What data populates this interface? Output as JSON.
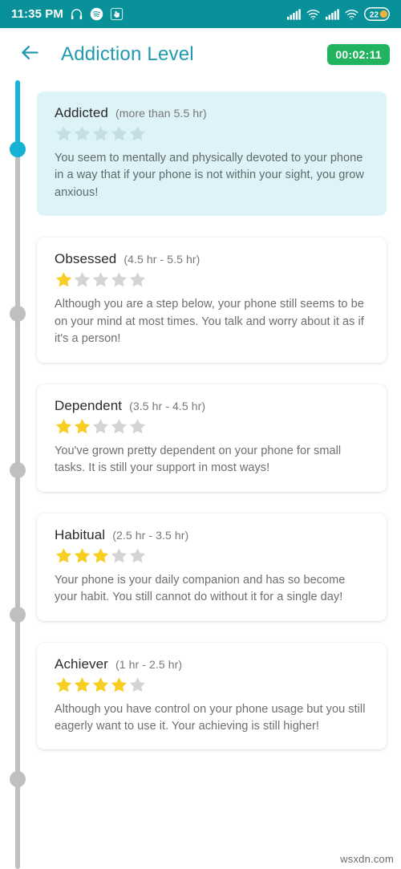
{
  "status_bar": {
    "time": "11:35 PM",
    "background": "#089199",
    "left_icons": [
      "headphones-icon",
      "spotify-icon",
      "touch-gesture-icon"
    ],
    "right_icons": [
      "signal-bars-icon",
      "wifi-calling-icon",
      "signal-bars-2-icon",
      "wifi-icon"
    ],
    "battery_percent": "22"
  },
  "app_bar": {
    "back_icon": "back-arrow-icon",
    "title": "Addiction Level",
    "title_color": "#1f9aae",
    "timer": "00:02:11",
    "timer_color": "#22b35e"
  },
  "timeline": {
    "active_color": "#16b2d4",
    "inactive_color": "#bfbfbf"
  },
  "levels": [
    {
      "name": "Addicted",
      "range": "(more than 5.5 hr)",
      "stars_filled": 0,
      "stars_total": 5,
      "description": "You seem to mentally and physically devoted to your phone in a way that if your phone is not within your sight, you grow anxious!",
      "highlighted": true,
      "background": "#ddf3f7"
    },
    {
      "name": "Obsessed",
      "range": "(4.5 hr - 5.5 hr)",
      "stars_filled": 1,
      "stars_total": 5,
      "description": "Although you are a step below, your phone still seems to be on your mind at most times. You talk and worry about it as if it's a person!",
      "highlighted": false,
      "background": "#ffffff"
    },
    {
      "name": "Dependent",
      "range": "(3.5 hr - 4.5 hr)",
      "stars_filled": 2,
      "stars_total": 5,
      "description": "You've grown pretty dependent on your phone for small tasks. It is still your support in most ways!",
      "highlighted": false,
      "background": "#ffffff"
    },
    {
      "name": "Habitual",
      "range": "(2.5 hr - 3.5 hr)",
      "stars_filled": 3,
      "stars_total": 5,
      "description": "Your phone is your daily companion and has so become your habit. You still cannot do without it for a single day!",
      "highlighted": false,
      "background": "#ffffff"
    },
    {
      "name": "Achiever",
      "range": "(1 hr - 2.5 hr)",
      "stars_filled": 4,
      "stars_total": 5,
      "description": "Although you have control on your phone usage but you still eagerly want to use it. Your achieving is still higher!",
      "highlighted": false,
      "background": "#ffffff"
    }
  ],
  "star_colors": {
    "filled": "#f7cf22",
    "empty": "#d4d4d4",
    "empty_on_highlight": "#c3dfe4"
  },
  "watermark": "wsxdn.com"
}
